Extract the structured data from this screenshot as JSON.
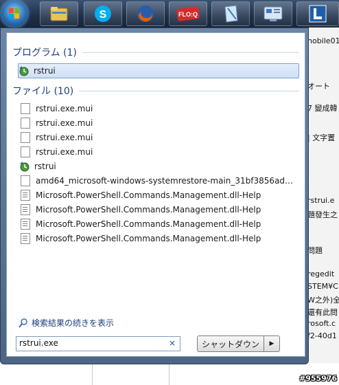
{
  "taskbar": {
    "buttons": [
      {
        "name": "start-orb",
        "icon": "windows-logo-icon"
      },
      {
        "name": "explorer",
        "icon": "folder-icon"
      },
      {
        "name": "skype",
        "icon": "skype-icon"
      },
      {
        "name": "firefox",
        "icon": "firefox-icon"
      },
      {
        "name": "floq",
        "icon": "floq-icon",
        "text": "FLO:Q"
      },
      {
        "name": "notes",
        "icon": "notes-icon"
      },
      {
        "name": "control",
        "icon": "control-panel-icon"
      },
      {
        "name": "app",
        "icon": "app-l-icon"
      }
    ]
  },
  "background_window": {
    "lines": [
      "nobile01",
      "オート",
      "7 變成韓",
      "| 文字置",
      "rstrui.e",
      "題發生之",
      "問題",
      "regedit",
      "STEM¥C",
      "W之外)全",
      "還有此問",
      "rosoft.c",
      "f2-40d1"
    ]
  },
  "start_menu": {
    "programs_header": "プログラム (1)",
    "programs": [
      {
        "label": "rstrui",
        "icon": "system-restore-icon",
        "selected": true
      }
    ],
    "files_header": "ファイル (10)",
    "files": [
      {
        "label": "rstrui.exe.mui",
        "icon": "file-icon"
      },
      {
        "label": "rstrui.exe.mui",
        "icon": "file-icon"
      },
      {
        "label": "rstrui.exe.mui",
        "icon": "file-icon"
      },
      {
        "label": "rstrui.exe.mui",
        "icon": "file-icon"
      },
      {
        "label": "rstrui",
        "icon": "system-restore-icon"
      },
      {
        "label": "amd64_microsoft-windows-systemrestore-main_31bf3856ad36...",
        "icon": "file-icon"
      },
      {
        "label": "Microsoft.PowerShell.Commands.Management.dll-Help",
        "icon": "help-file-icon"
      },
      {
        "label": "Microsoft.PowerShell.Commands.Management.dll-Help",
        "icon": "help-file-icon"
      },
      {
        "label": "Microsoft.PowerShell.Commands.Management.dll-Help",
        "icon": "help-file-icon"
      },
      {
        "label": "Microsoft.PowerShell.Commands.Management.dll-Help",
        "icon": "help-file-icon"
      }
    ],
    "see_more": "検索結果の続きを表示",
    "search_value": "rstrui.exe",
    "clear_glyph": "×",
    "shutdown_label": "シャットダウン",
    "shutdown_arrow": "▶"
  },
  "watermark": "#955976",
  "colors": {
    "accent": "#1e3d7a",
    "taskbar": "#1d2f49",
    "selection": "#cfe0f6"
  }
}
